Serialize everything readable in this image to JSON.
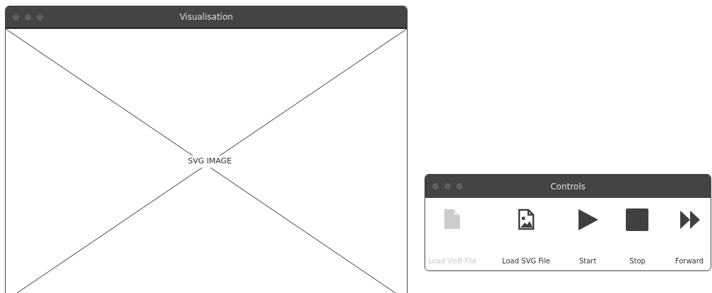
{
  "visualisation_window": {
    "title": "Visualisation",
    "placeholder_label": "SVG IMAGE"
  },
  "controls_window": {
    "title": "Controls",
    "buttons": [
      {
        "label": "Load VisB File",
        "kind": "file",
        "disabled": true
      },
      {
        "label": "Load SVG File",
        "kind": "image-file",
        "disabled": false
      },
      {
        "label": "Start",
        "kind": "play",
        "disabled": false
      },
      {
        "label": "Stop",
        "kind": "stop",
        "disabled": false
      },
      {
        "label": "Forward",
        "kind": "forward",
        "disabled": false
      }
    ]
  }
}
